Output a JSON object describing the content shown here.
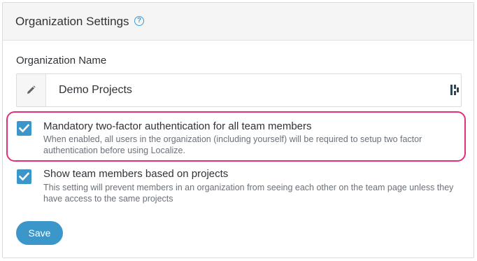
{
  "header": {
    "title": "Organization Settings",
    "help_icon": "question-circle-icon",
    "help_glyph": "?"
  },
  "org_name": {
    "label": "Organization Name",
    "value": "Demo Projects",
    "addon_icon": "pencil-icon",
    "extension_icon": "password-manager-icon"
  },
  "options": [
    {
      "checked": true,
      "title": "Mandatory two-factor authentication for all team members",
      "description": "When enabled, all users in the organization (including yourself) will be required to setup two factor authentication before using Localize."
    },
    {
      "checked": true,
      "title": "Show team members based on projects",
      "description": "This setting will prevent members in an organization from seeing each other on the team page unless they have access to the same projects"
    }
  ],
  "save_button": {
    "label": "Save"
  },
  "colors": {
    "accent": "#3b97c9",
    "highlight": "#e0307a",
    "header_bg": "#f5f5f5"
  }
}
